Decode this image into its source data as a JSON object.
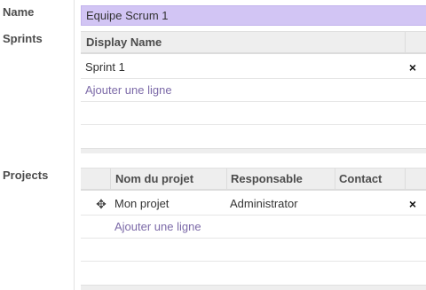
{
  "form": {
    "name_label": "Name",
    "name_value": "Equipe Scrum 1",
    "sprints_label": "Sprints",
    "projects_label": "Projects"
  },
  "sprints": {
    "columns": [
      "Display Name"
    ],
    "rows": [
      {
        "display_name": "Sprint 1"
      }
    ],
    "add_line": "Ajouter une ligne",
    "delete_icon": "×"
  },
  "projects": {
    "columns": [
      "Nom du projet",
      "Responsable",
      "Contact"
    ],
    "rows": [
      {
        "name": "Mon projet",
        "responsable": "Administrator",
        "contact": ""
      }
    ],
    "add_line": "Ajouter une ligne",
    "delete_icon": "×",
    "handle_icon": "✥"
  },
  "colors": {
    "input_bg": "#d2c5f4",
    "link": "#7c6aa8"
  }
}
